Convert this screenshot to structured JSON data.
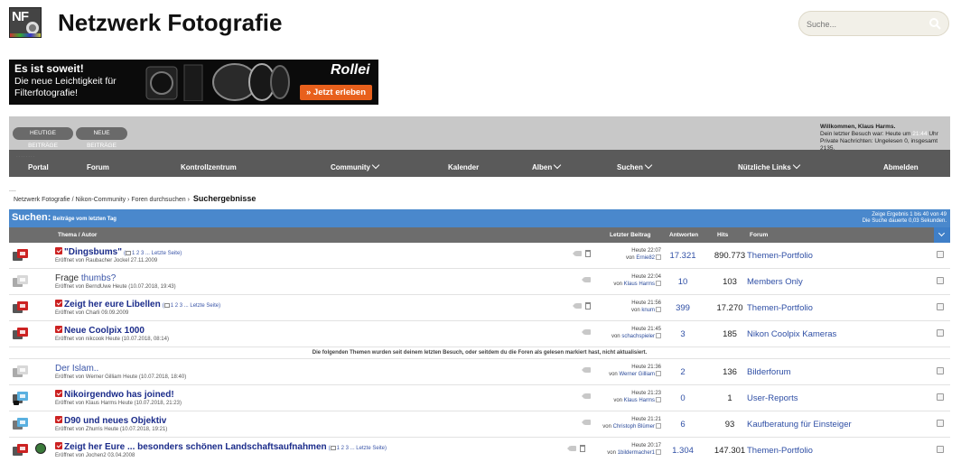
{
  "header": {
    "logo_text": "NF",
    "site_title": "Netzwerk Fotografie",
    "search_placeholder": "Suche..."
  },
  "banner": {
    "headline": "Es ist soweit!",
    "text": "Die neue Leichtigkeit für Filterfotografie!",
    "brand": "Rollei",
    "cta": "» Jetzt erleben"
  },
  "userbar": {
    "btn_today": "HEUTIGE BEITRÄGE",
    "btn_new": "NEUE BEITRÄGE",
    "welcome": "Willkommen, Klaus Harms.",
    "last_visit_prefix": "Dein letzter Besuch war: Heute um",
    "last_visit_time": "21:44",
    "last_visit_suffix": "Uhr",
    "pm": "Private Nachrichten: Ungelesen 0, insgesamt 2135."
  },
  "nav": {
    "dots": "........",
    "items": [
      {
        "label": "Portal"
      },
      {
        "label": "Forum"
      },
      {
        "label": "Kontrollzentrum"
      },
      {
        "label": "Community"
      },
      {
        "label": "Kalender"
      },
      {
        "label": "Alben"
      },
      {
        "label": "Suchen"
      },
      {
        "label": "Nützliche Links"
      },
      {
        "label": "Abmelden"
      }
    ]
  },
  "breadcrumb": {
    "dots": "....",
    "path": "Netzwerk Fotografie / Nikon-Community  ›  Foren durchsuchen  ›",
    "current": "Suchergebnisse"
  },
  "results": {
    "title": "Suchen:",
    "subtitle": "Beiträge vom letzten Tag",
    "info_line1": "Zeige Ergebnis 1 bis 40 von 49",
    "info_line2": "Die Suche dauerte 0,03 Sekunden.",
    "columns": {
      "topic": "Thema / Autor",
      "last": "Letzter Beitrag",
      "answers": "Antworten",
      "hits": "Hits",
      "forum": "Forum"
    },
    "notice": "Die folgenden Themen wurden seit deinem letzten Besuch, oder seitdem du die Foren als gelesen markiert hast, nicht aktualisiert.",
    "rows": [
      {
        "title": "\"Dingsbums\"",
        "pages": "1 2 3 ... Letzte Seite)",
        "sub": "Eröffnet von Raubacher Jockel 27.11.2009",
        "last_time": "Heute 22:07",
        "last_user": "Ernie82",
        "answers": "17.321",
        "hits": "890.773",
        "forum": "Themen-Portfolio"
      },
      {
        "title_dark": "Frage",
        "title_link": "thumbs?",
        "sub": "Eröffnet von BerndUwe Heute (10.07.2018, 19:43)",
        "last_time": "Heute 22:04",
        "last_user": "Klaus Harms",
        "answers": "10",
        "hits": "103",
        "forum": "Members Only"
      },
      {
        "title": "Zeigt her eure Libellen",
        "pages": "1 2 3 ... Letzte Seite)",
        "sub": "Eröffnet von Charli 09.09.2009",
        "last_time": "Heute 21:56",
        "last_user": "knum",
        "answers": "399",
        "hits": "17.270",
        "forum": "Themen-Portfolio"
      },
      {
        "title": "Neue Coolpix 1000",
        "sub": "Eröffnet von nikcook Heute (10.07.2018, 08:14)",
        "last_time": "Heute 21:45",
        "last_user": "schachspieler",
        "answers": "3",
        "hits": "185",
        "forum": "Nikon Coolpix Kameras"
      },
      {
        "title_plain": "Der Islam..",
        "sub": "Eröffnet von Werner Gilliam Heute (10.07.2018, 18:40)",
        "last_time": "Heute 21:36",
        "last_user": "Werner Gilliam",
        "answers": "2",
        "hits": "136",
        "forum": "Bilderforum"
      },
      {
        "title": "Nikoirgendwo has joined!",
        "sub": "Eröffnet von Klaus Harms Heute (10.07.2018, 21:23)",
        "last_time": "Heute 21:23",
        "last_user": "Klaus Harms",
        "answers": "0",
        "hits": "1",
        "forum": "User-Reports"
      },
      {
        "title": "D90 und neues Objektiv",
        "sub": "Eröffnet von Zhurris Heute (10.07.2018, 19:21)",
        "last_time": "Heute 21:21",
        "last_user": "Christoph Blümer",
        "answers": "6",
        "hits": "93",
        "forum": "Kaufberatung für Einsteiger"
      },
      {
        "title": "Zeigt her Eure ... besonders schönen Landschaftsaufnahmen",
        "pages": "1 2 3 ... Letzte Seite)",
        "sub": "Eröffnet von Jochen2 03.04.2008",
        "last_time": "Heute 20:17",
        "last_user": "1bildermacher1",
        "answers": "1.304",
        "hits": "147.301",
        "forum": "Themen-Portfolio"
      }
    ]
  },
  "colors": {
    "nav_bg": "#5a5a5a",
    "userbar_bg": "#c8c8c8",
    "results_head": "#4a88cc",
    "col_head": "#6d6d6d",
    "topic_link": "#1a2b8a",
    "forum_link": "#2f4fa5",
    "icon_red": "#cc2222",
    "icon_blue": "#5ab0e0",
    "icon_gray": "#cfcfcf",
    "cta_orange": "#e8601c"
  },
  "icons": [
    "search-icon",
    "topic-hot-icon",
    "topic-read-icon",
    "tag-icon",
    "trash-icon",
    "goto-last-icon",
    "globe-icon",
    "dropdown-icon"
  ]
}
